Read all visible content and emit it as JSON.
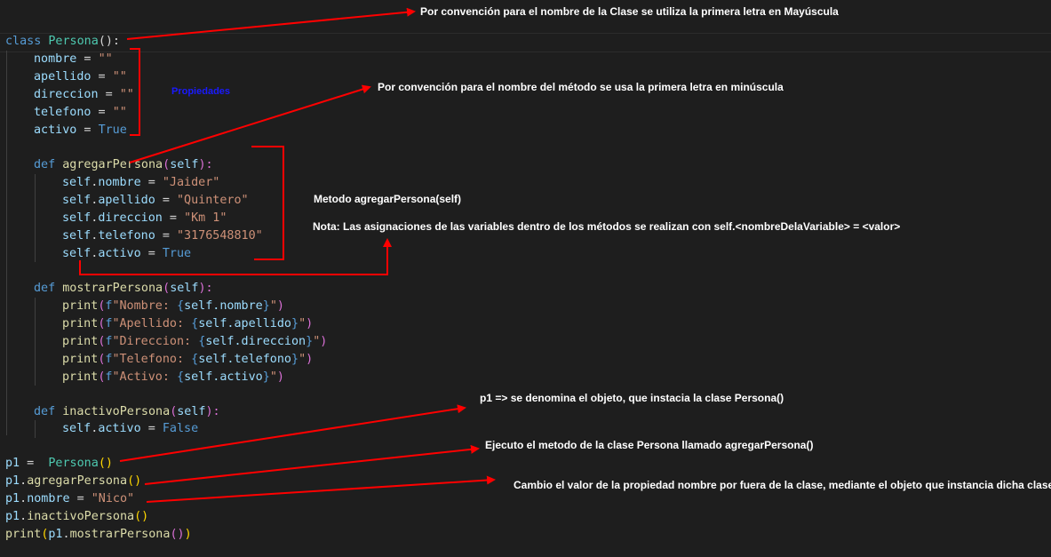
{
  "code": {
    "l1": [
      "class",
      " ",
      "Persona",
      "():"
    ],
    "l2": [
      "nombre",
      " = ",
      "\"\""
    ],
    "l3": [
      "apellido",
      " = ",
      "\"\""
    ],
    "l4": [
      "direccion",
      " = ",
      "\"\""
    ],
    "l5": [
      "telefono",
      " = ",
      "\"\""
    ],
    "l6": [
      "activo",
      " = ",
      "True"
    ],
    "l8": [
      "def",
      " ",
      "agregarPersona",
      "(",
      "self",
      "):"
    ],
    "l9": [
      "self",
      ".",
      "nombre",
      " = ",
      "\"Jaider\""
    ],
    "l10": [
      "self",
      ".",
      "apellido",
      " = ",
      "\"Quintero\""
    ],
    "l11": [
      "self",
      ".",
      "direccion",
      " = ",
      "\"Km 1\""
    ],
    "l12": [
      "self",
      ".",
      "telefono",
      " = ",
      "\"3176548810\""
    ],
    "l13": [
      "self",
      ".",
      "activo",
      " = ",
      "True"
    ],
    "l15": [
      "def",
      " ",
      "mostrarPersona",
      "(",
      "self",
      "):"
    ],
    "l16": [
      "print",
      "(",
      "f",
      "\"Nombre: ",
      "{",
      "self.nombre",
      "}",
      "\"",
      ")"
    ],
    "l17": [
      "print",
      "(",
      "f",
      "\"Apellido: ",
      "{",
      "self.apellido",
      "}",
      "\"",
      ")"
    ],
    "l18": [
      "print",
      "(",
      "f",
      "\"Direccion: ",
      "{",
      "self.direccion",
      "}",
      "\"",
      ")"
    ],
    "l19": [
      "print",
      "(",
      "f",
      "\"Telefono: ",
      "{",
      "self.telefono",
      "}",
      "\"",
      ")"
    ],
    "l20": [
      "print",
      "(",
      "f",
      "\"Activo: ",
      "{",
      "self.activo",
      "}",
      "\"",
      ")"
    ],
    "l22": [
      "def",
      " ",
      "inactivoPersona",
      "(",
      "self",
      "):"
    ],
    "l23": [
      "self",
      ".",
      "activo",
      " = ",
      "False"
    ],
    "l25": [
      "p1",
      " =  ",
      "Persona",
      "()"
    ],
    "l26": [
      "p1",
      ".",
      "agregarPersona",
      "()"
    ],
    "l27": [
      "p1",
      ".",
      "nombre",
      " = ",
      "\"Nico\""
    ],
    "l28": [
      "p1",
      ".",
      "inactivoPersona",
      "()"
    ],
    "l29": [
      "print",
      "(",
      "p1",
      ".",
      "mostrarPersona",
      "()",
      ")"
    ]
  },
  "annotations": {
    "clase": "Por convención para el nombre de la Clase se utiliza la primera letra en Mayúscula",
    "propiedades": "Propiedades",
    "metodo_conv": "Por convención para el nombre del método se usa la primera letra en minúscula",
    "metodo_nombre": "Metodo agregarPersona(self)",
    "nota": "Nota: Las asignaciones de las variables dentro de los métodos se realizan con self.<nombreDelaVariable> = <valor>",
    "objeto": "p1 => se denomina el objeto, que instacia la clase Persona()",
    "ejecuto": "Ejecuto el metodo de la clase Persona llamado agregarPersona()",
    "cambio": "Cambio el valor de la propiedad nombre por fuera de la clase, mediante el objeto que instancia dicha clase"
  },
  "colors": {
    "background": "#1e1e1e",
    "keyword": "#569cd6",
    "class_name": "#4ec9b0",
    "function": "#dcdcaa",
    "variable": "#9cdcfe",
    "string": "#ce9178",
    "annotation_arrow": "#ff0000"
  }
}
